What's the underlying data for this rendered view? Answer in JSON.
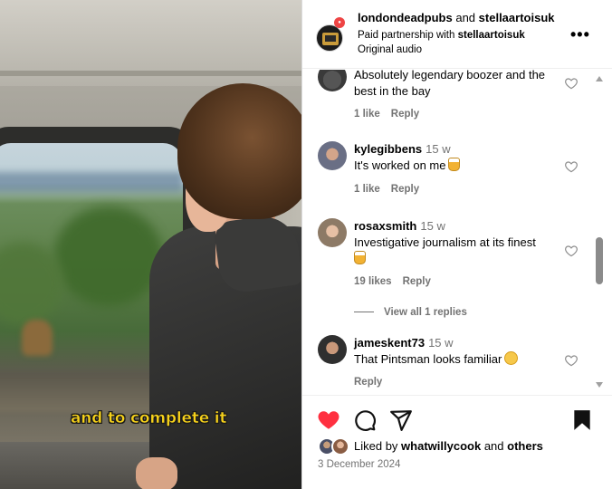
{
  "video": {
    "caption": "and to complete it"
  },
  "post": {
    "author": "londondeadpubs",
    "connector": "and",
    "collaborator": "stellaartoisuk",
    "partnership_prefix": "Paid partnership with",
    "partner": "stellaartoisuk",
    "audio": "Original audio",
    "more_icon": "ellipsis-icon",
    "more_label": "•••"
  },
  "comments": [
    {
      "text": "Absolutely legendary boozer and the best in the bay",
      "likes": "1 like",
      "reply": "Reply"
    },
    {
      "user": "kylegibbens",
      "age": "15 w",
      "text": "It's worked on me",
      "emoji": "beer-mug-emoji",
      "likes": "1 like",
      "reply": "Reply"
    },
    {
      "user": "rosaxsmith",
      "age": "15 w",
      "text": "Investigative journalism at its finest",
      "emoji": "beer-mug-emoji",
      "likes": "19 likes",
      "reply": "Reply",
      "view_replies": "View all 1 replies"
    },
    {
      "user": "jameskent73",
      "age": "15 w",
      "text": "That Pintsman looks familiar",
      "emoji": "face-with-monocle-emoji",
      "reply": "Reply"
    }
  ],
  "actions": {
    "like_icon": "heart-filled-icon",
    "comment_icon": "comment-bubble-icon",
    "share_icon": "paper-plane-icon",
    "save_icon": "bookmark-filled-icon",
    "like_color": "#ff3040"
  },
  "likes": {
    "prefix": "Liked by",
    "user": "whatwillycook",
    "conj": "and",
    "others": "others"
  },
  "date": "3 December 2024"
}
